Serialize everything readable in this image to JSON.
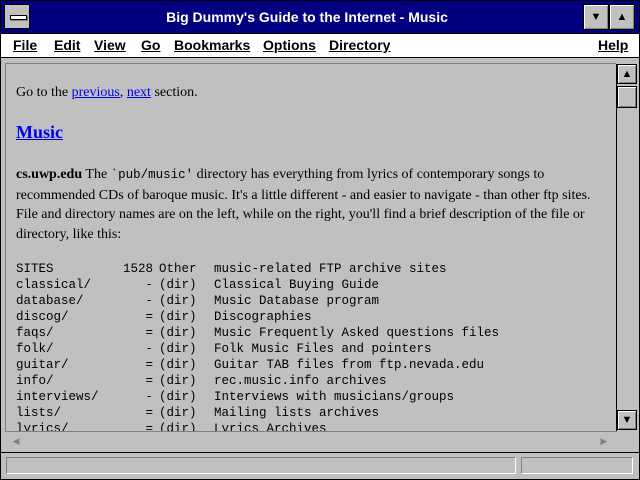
{
  "window": {
    "title": "Big Dummy's Guide to the Internet - Music"
  },
  "menu": [
    {
      "label": "File"
    },
    {
      "label": "Edit"
    },
    {
      "label": "View"
    },
    {
      "label": "Go"
    },
    {
      "label": "Bookmarks"
    },
    {
      "label": "Options"
    },
    {
      "label": "Directory"
    },
    {
      "label": "Help"
    }
  ],
  "page": {
    "nav_prefix": "Go to the ",
    "nav_previous": "previous",
    "nav_sep": ", ",
    "nav_next": "next",
    "nav_suffix": " section.",
    "heading": "Music",
    "site": "cs.uwp.edu",
    "para_before_code": " The ",
    "code": "`pub/music'",
    "para_after_code": " directory has everything from lyrics of contemporary songs to recommended CDs of baroque music. It's a little different - and easier to navigate - than other ftp sites. File and directory names are on the left, while on the right, you'll find a brief description of the file or directory, like this:",
    "listing": [
      {
        "name": "SITES",
        "size": "1528",
        "type": "Other",
        "desc": "music-related FTP archive sites"
      },
      {
        "name": "classical/",
        "size": "-",
        "type": "(dir)",
        "desc": "Classical Buying Guide"
      },
      {
        "name": "database/",
        "size": "-",
        "type": "(dir)",
        "desc": "Music Database program"
      },
      {
        "name": "discog/",
        "size": "=",
        "type": "(dir)",
        "desc": "Discographies"
      },
      {
        "name": "faqs/",
        "size": "=",
        "type": "(dir)",
        "desc": "Music Frequently Asked questions files"
      },
      {
        "name": "folk/",
        "size": "-",
        "type": "(dir)",
        "desc": "Folk Music Files and pointers"
      },
      {
        "name": "guitar/",
        "size": "=",
        "type": "(dir)",
        "desc": "Guitar TAB files from ftp.nevada.edu"
      },
      {
        "name": "info/",
        "size": "=",
        "type": "(dir)",
        "desc": "rec.music.info archives"
      },
      {
        "name": "interviews/",
        "size": "-",
        "type": "(dir)",
        "desc": "Interviews with musicians/groups"
      },
      {
        "name": "lists/",
        "size": "=",
        "type": "(dir)",
        "desc": "Mailing lists archives"
      },
      {
        "name": "lyrics/",
        "size": "=",
        "type": "(dir)",
        "desc": "Lyrics Archives"
      }
    ]
  },
  "icons": {
    "minimize": "▼",
    "maximize": "▲",
    "scroll_up": "▲",
    "scroll_down": "▼",
    "scroll_left": "◀",
    "scroll_right": "▶"
  },
  "colors": {
    "titlebar": "#000080",
    "link": "#0000ee",
    "background": "#c0c0c0"
  }
}
